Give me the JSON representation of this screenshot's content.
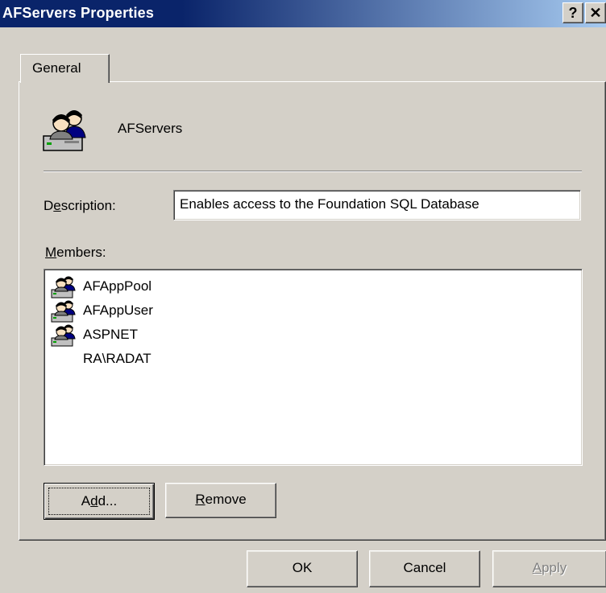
{
  "window": {
    "title": "AFServers Properties",
    "help_glyph": "?",
    "close_glyph": "✕"
  },
  "tabs": [
    {
      "label": "General",
      "selected": true
    }
  ],
  "group": {
    "name": "AFServers",
    "icon": "group-users-icon"
  },
  "description": {
    "label_before": "D",
    "label_accel": "e",
    "label_after": "scription:",
    "value": "Enables access to the Foundation SQL Database"
  },
  "members": {
    "label_accel": "M",
    "label_after": "embers:",
    "items": [
      {
        "name": "AFAppPool",
        "icon": "group-users-icon"
      },
      {
        "name": "AFAppUser",
        "icon": "group-users-icon"
      },
      {
        "name": "ASPNET",
        "icon": "group-users-icon"
      },
      {
        "name": "RA\\RADAT",
        "icon": ""
      }
    ]
  },
  "buttons": {
    "add_before": "A",
    "add_accel": "d",
    "add_after": "d...",
    "remove_accel": "R",
    "remove_after": "emove",
    "ok": "OK",
    "cancel": "Cancel",
    "apply_accel": "A",
    "apply_after": "pply",
    "apply_enabled": false
  },
  "colors": {
    "titlebar_start": "#0a246a",
    "titlebar_end": "#a6caf0",
    "face": "#d4d0c8"
  }
}
